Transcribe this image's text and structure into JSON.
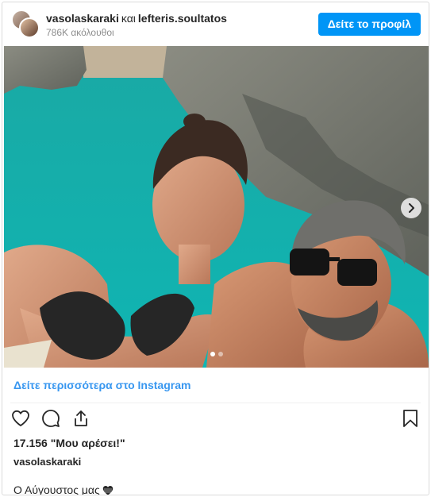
{
  "header": {
    "user1": "vasolaskaraki",
    "and_word": "και",
    "user2": "lefteris.soultatos",
    "followers": "786K ακόλουθοι",
    "view_profile_label": "Δείτε το προφίλ"
  },
  "post": {
    "more_link": "Δείτε περισσότερα στο Instagram",
    "likes": "17.156 \"Μου αρέσει!\"",
    "caption_user": "vasolaskaraki",
    "caption_text": "Ο Αύγουστος μας",
    "caption_emoji_icon": "black-heart-icon"
  },
  "carousel": {
    "slide_count": 2,
    "active_index": 0
  },
  "icons": {
    "like": "heart-icon",
    "comment": "comment-bubble-icon",
    "share": "share-icon",
    "save": "bookmark-icon",
    "next": "chevron-right-icon"
  },
  "colors": {
    "accent": "#0095f6",
    "link": "#3897f0",
    "text": "#262626",
    "muted": "#8e8e8e"
  }
}
